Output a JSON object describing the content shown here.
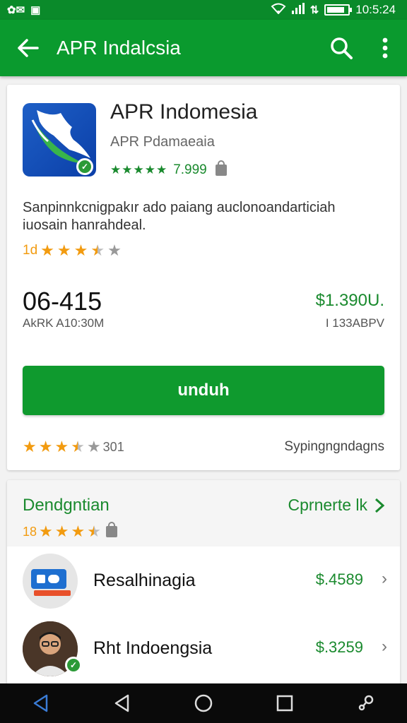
{
  "status_bar": {
    "left_icons": [
      "app-icon-a",
      "app-icon-b"
    ],
    "clock": "10:5:24",
    "battery_level": 0.85
  },
  "app_bar": {
    "title": "APR Indalcsia",
    "actions": [
      "search-icon",
      "more-vert-icon"
    ]
  },
  "app": {
    "name": "APR Indomesia",
    "developer": "APR Pdamaeaia",
    "rating_value": "7.999",
    "rating_stars": 5,
    "description": "Sanpinnkcnigpakır ado paiang auclonoandarticiah iuosain hanrahdeal.",
    "rating_prefix": "1d",
    "secondary_rating_stars": 3.5
  },
  "stats": {
    "downloads_value": "06-415",
    "downloads_label": "AkRK A10:30M",
    "price": "$1.390U.",
    "price_label": "I 133ABPV"
  },
  "install_button": {
    "label": "unduh"
  },
  "review_row": {
    "stars": 3.5,
    "count": "301",
    "meta": "Sypingngndagns"
  },
  "section": {
    "title": "Dendgntian",
    "more_label": "Cprnerte lk",
    "rating_prefix": "18",
    "rating_stars": 3.5
  },
  "list": [
    {
      "title": "Resalhinagia",
      "price": "$.4589",
      "icon": "ticket-icon"
    },
    {
      "title": "Rht Indoengsia",
      "price": "$.3259",
      "icon": "avatar-icon"
    }
  ],
  "nav": [
    "back-icon",
    "home-icon",
    "recents-icon",
    "assist-icon"
  ],
  "colors": {
    "primary": "#0a9a2e",
    "status": "#0a8a2a",
    "accent_text": "#1a8a2e",
    "star": "#f29b10"
  }
}
